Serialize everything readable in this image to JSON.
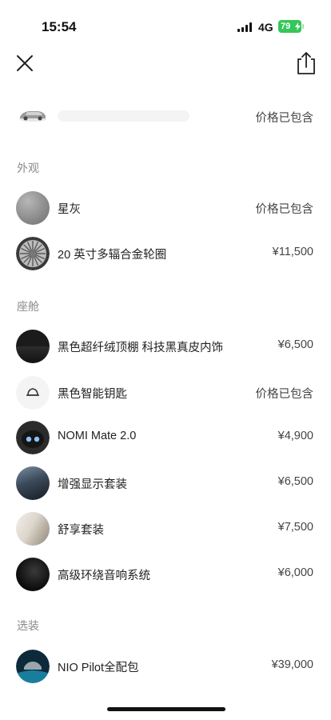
{
  "status_bar": {
    "time": "15:54",
    "network": "4G",
    "battery": "79"
  },
  "header": {
    "close_icon": "close-icon",
    "share_icon": "share-icon"
  },
  "summary": {
    "price": "价格已包含"
  },
  "sections": {
    "exterior": "外观",
    "cabin": "座舱",
    "options": "选装"
  },
  "exterior_items": [
    {
      "label": "星灰",
      "price": "价格已包含"
    },
    {
      "label": "20 英寸多辐合金轮圈",
      "price": "¥11,500"
    }
  ],
  "cabin_items": [
    {
      "label": "黑色超纤绒顶棚 科技黑真皮内饰",
      "price": "¥6,500"
    },
    {
      "label": "黑色智能钥匙",
      "price": "价格已包含"
    },
    {
      "label": "NOMI Mate 2.0",
      "price": "¥4,900"
    },
    {
      "label": "增强显示套装",
      "price": "¥6,500"
    },
    {
      "label": "舒享套装",
      "price": "¥7,500"
    },
    {
      "label": "高级环绕音响系统",
      "price": "¥6,000"
    }
  ],
  "option_items": [
    {
      "label": "NIO Pilot全配包",
      "price": "¥39,000"
    }
  ],
  "colors": {
    "battery": "#35c759",
    "section_title": "#8a8a8a",
    "text": "#222222"
  }
}
